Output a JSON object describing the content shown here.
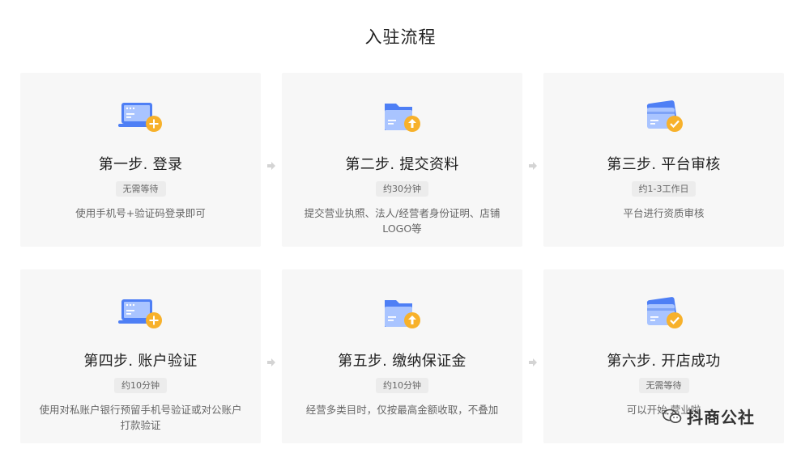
{
  "page": {
    "title": "入驻流程"
  },
  "steps": [
    {
      "title": "第一步. 登录",
      "badge": "无需等待",
      "desc": "使用手机号+验证码登录即可",
      "icon": "laptop-plus-icon"
    },
    {
      "title": "第二步. 提交资料",
      "badge": "约30分钟",
      "desc": "提交营业执照、法人/经营者身份证明、店铺LOGO等",
      "icon": "folder-upload-icon"
    },
    {
      "title": "第三步. 平台审核",
      "badge": "约1-3工作日",
      "desc": "平台进行资质审核",
      "icon": "card-check-icon"
    },
    {
      "title": "第四步. 账户验证",
      "badge": "约10分钟",
      "desc": "使用对私账户银行预留手机号验证或对公账户打款验证",
      "icon": "laptop-plus-icon"
    },
    {
      "title": "第五步. 缴纳保证金",
      "badge": "约10分钟",
      "desc": "经营多类目时，仅按最高金额收取，不叠加",
      "icon": "folder-upload-icon"
    },
    {
      "title": "第六步. 开店成功",
      "badge": "无需等待",
      "desc": "可以开始  营业啦",
      "icon": "card-check-icon"
    }
  ],
  "watermark": {
    "text": "抖商公社",
    "icon": "wechat-icon"
  },
  "colors": {
    "blue": "#4e7ff5",
    "light_blue": "#a9c4ff",
    "orange": "#f7b12b",
    "card_bg": "#f7f7f7"
  }
}
